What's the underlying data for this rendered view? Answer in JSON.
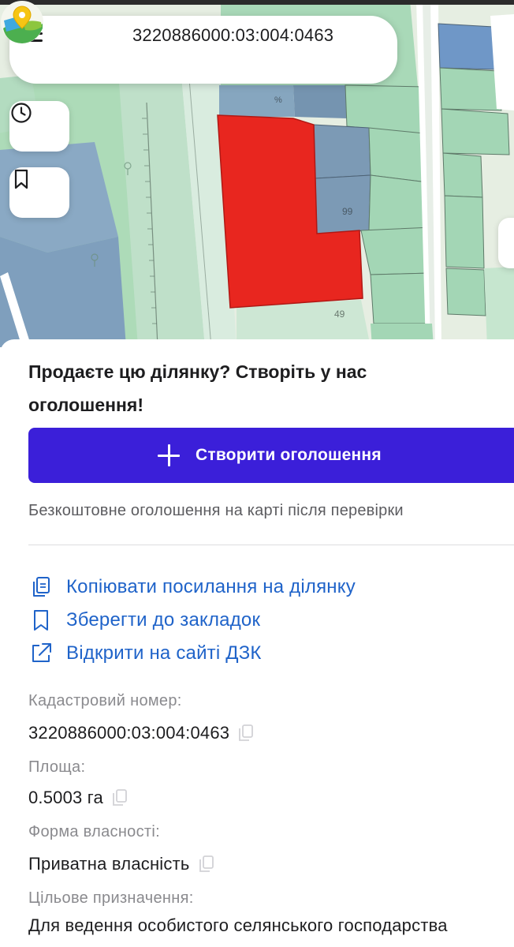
{
  "search": {
    "query": "3220886000:03:004:0463"
  },
  "sheet": {
    "promo_title": "Продаєте цю ділянку? Створіть у нас оголошення!",
    "create_button_label": "Створити оголошення",
    "free_note": "Безкоштовне оголошення на карті після перевірки",
    "actions": [
      {
        "label": "Копіювати посилання на ділянку",
        "icon": "copy-link-icon"
      },
      {
        "label": "Зберегти до закладок",
        "icon": "bookmark-icon"
      },
      {
        "label": "Відкрити на сайті ДЗК",
        "icon": "external-link-icon"
      }
    ],
    "fields": [
      {
        "label": "Кадастровий номер:",
        "value": "3220886000:03:004:0463"
      },
      {
        "label": "Площа:",
        "value": "0.5003 га"
      },
      {
        "label": "Форма власності:",
        "value": "Приватна власність"
      },
      {
        "label": "Цільове призначення:",
        "value": "Для ведення особистого селянського господарства"
      }
    ]
  },
  "map": {
    "icons": [
      "menu-icon",
      "app-logo-icon",
      "clock-icon",
      "bookmark-icon"
    ],
    "colors": {
      "selected_parcel": "#e8261f",
      "parcel_green": "#9fd3b2",
      "parcel_blue": "#7e9fb8",
      "primary_button": "#3b1fd9",
      "link": "#1f63c9"
    }
  }
}
